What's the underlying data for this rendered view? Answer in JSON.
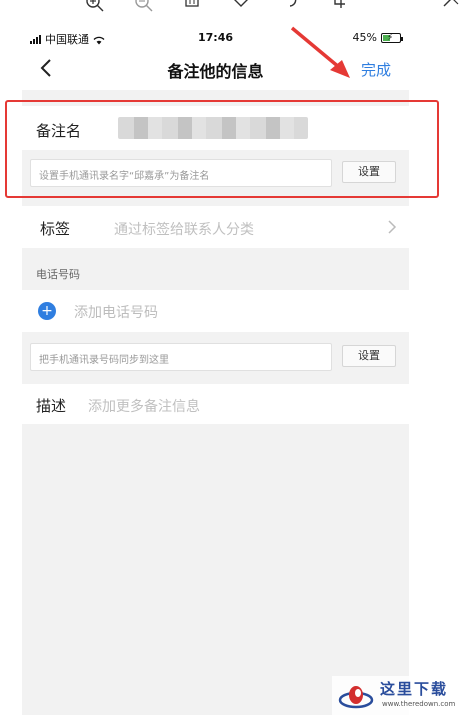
{
  "status": {
    "carrier": "中国联通",
    "time": "17:46",
    "battery": "45%",
    "battery_level": 0.45
  },
  "nav": {
    "title": "备注他的信息",
    "done_label": "完成"
  },
  "remark": {
    "label": "备注名",
    "sync_placeholder": "设置手机通讯录名字“邱嘉承”为备注名",
    "set_label": "设置"
  },
  "tags": {
    "label": "标签",
    "hint": "通过标签给联系人分类"
  },
  "phone": {
    "section_label": "电话号码",
    "add_label": "添加电话号码",
    "sync_placeholder": "把手机通讯录号码同步到这里",
    "set_label": "设置"
  },
  "description": {
    "label": "描述",
    "hint": "添加更多备注信息"
  },
  "watermark": {
    "text": "这里下载",
    "url": "www.theredown.com"
  },
  "colors": {
    "accent": "#2f7ee0",
    "annotation": "#e53935"
  }
}
